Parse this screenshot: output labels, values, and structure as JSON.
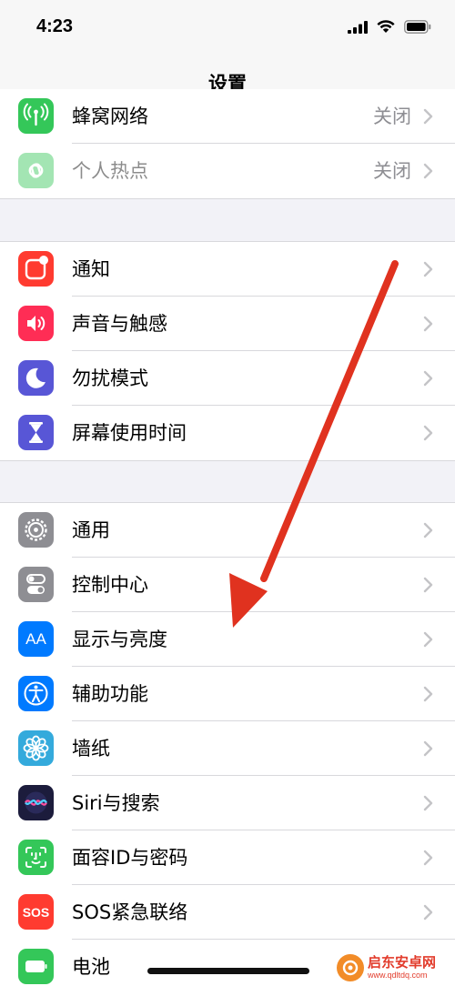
{
  "status": {
    "time": "4:23"
  },
  "nav": {
    "title": "设置"
  },
  "groups": [
    {
      "items": [
        {
          "label": "蜂窝网络",
          "value": "关闭",
          "icon": "cellular-icon",
          "color": "#34c759"
        },
        {
          "label": "个人热点",
          "value": "关闭",
          "icon": "hotspot-icon",
          "color": "#34c759",
          "dimmed": true
        }
      ]
    },
    {
      "items": [
        {
          "label": "通知",
          "icon": "notifications-icon",
          "color": "#ff3b30"
        },
        {
          "label": "声音与触感",
          "icon": "sound-icon",
          "color": "#ff2d55"
        },
        {
          "label": "勿扰模式",
          "icon": "moon-icon",
          "color": "#5856d6"
        },
        {
          "label": "屏幕使用时间",
          "icon": "hourglass-icon",
          "color": "#5856d6"
        }
      ]
    },
    {
      "items": [
        {
          "label": "通用",
          "icon": "gear-icon",
          "color": "#8e8e93"
        },
        {
          "label": "控制中心",
          "icon": "toggles-icon",
          "color": "#8e8e93"
        },
        {
          "label": "显示与亮度",
          "icon": "display-icon",
          "color": "#007aff",
          "icon_text": "AA"
        },
        {
          "label": "辅助功能",
          "icon": "accessibility-icon",
          "color": "#007aff"
        },
        {
          "label": "墙纸",
          "icon": "wallpaper-icon",
          "color": "#34aadc"
        },
        {
          "label": "Siri与搜索",
          "icon": "siri-icon",
          "color": "#1c1c3c"
        },
        {
          "label": "面容ID与密码",
          "icon": "faceid-icon",
          "color": "#34c759"
        },
        {
          "label": "SOS紧急联络",
          "icon": "sos-icon",
          "color": "#ff3b30",
          "icon_text": "SOS"
        },
        {
          "label": "电池",
          "icon": "battery-icon",
          "color": "#34c759"
        }
      ]
    }
  ],
  "watermark": {
    "name": "启东安卓网",
    "url": "www.qdltdq.com"
  },
  "colors": {
    "arrow": "#e0321f",
    "background": "#f2f2f7"
  }
}
